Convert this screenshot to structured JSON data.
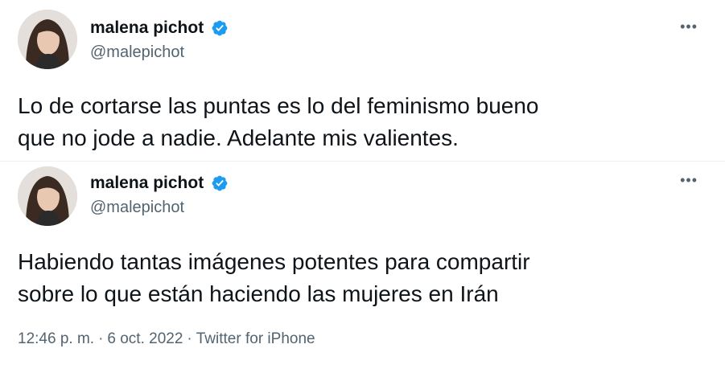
{
  "tweets": [
    {
      "author": {
        "display_name": "malena pichot",
        "handle": "@malepichot",
        "verified": true
      },
      "more_label": "•••",
      "text": "Lo de cortarse las puntas es lo del feminismo bueno\nque no jode a nadie. Adelante mis valientes."
    },
    {
      "author": {
        "display_name": "malena pichot",
        "handle": "@malepichot",
        "verified": true
      },
      "more_label": "•••",
      "text": "Habiendo tantas imágenes potentes para compartir\nsobre lo que están haciendo las mujeres en Irán",
      "meta": {
        "time": "12:46 p. m.",
        "separator": "·",
        "date": "6 oct. 2022",
        "source": "Twitter for iPhone"
      }
    }
  ],
  "colors": {
    "text_primary": "#0f1419",
    "text_secondary": "#536471",
    "verified_badge": "#1d9bf0",
    "divider": "#eff3f4"
  },
  "icons": {
    "verified": "verified-badge-icon",
    "more": "more-options-icon"
  }
}
